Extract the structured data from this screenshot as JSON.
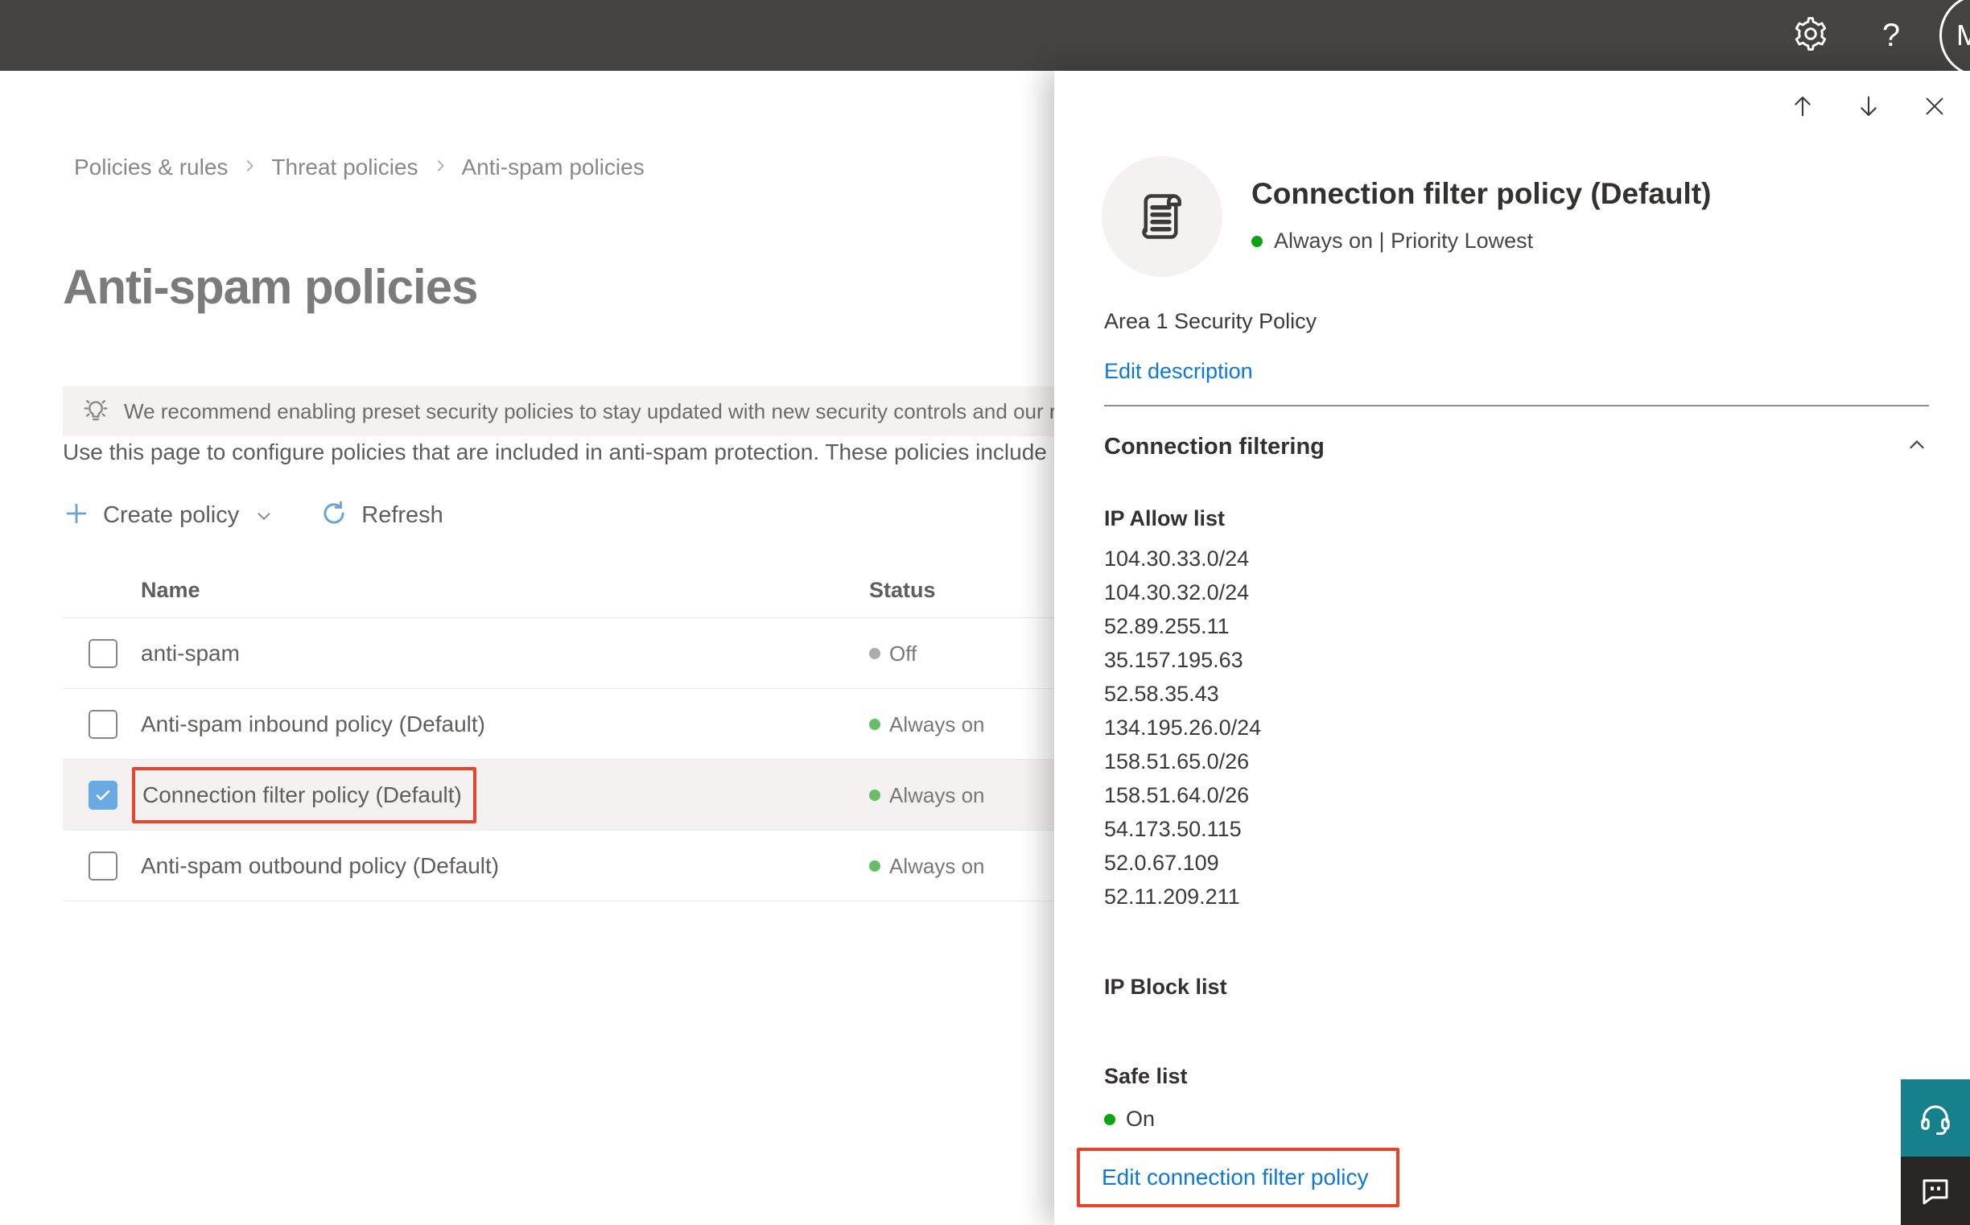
{
  "topbar": {
    "help_label": "?",
    "avatar_initial": "M"
  },
  "breadcrumb": {
    "items": [
      "Policies & rules",
      "Threat policies",
      "Anti-spam policies"
    ]
  },
  "page": {
    "title": "Anti-spam policies",
    "banner_text": "We recommend enabling preset security policies to stay updated with new security controls and our recomme",
    "description": "Use this page to configure policies that are included in anti-spam protection. These policies include",
    "toolbar": {
      "create_policy_label": "Create policy",
      "refresh_label": "Refresh"
    }
  },
  "table": {
    "columns": {
      "name": "Name",
      "status": "Status"
    },
    "rows": [
      {
        "name": "anti-spam",
        "status": "Off",
        "checked": false,
        "selected": false
      },
      {
        "name": "Anti-spam inbound policy (Default)",
        "status": "Always on",
        "checked": false,
        "selected": false
      },
      {
        "name": "Connection filter policy (Default)",
        "status": "Always on",
        "checked": true,
        "selected": true,
        "annotated": true
      },
      {
        "name": "Anti-spam outbound policy (Default)",
        "status": "Always on",
        "checked": false,
        "selected": false
      }
    ]
  },
  "panel": {
    "title": "Connection filter policy (Default)",
    "status_line": "Always on | Priority Lowest",
    "description": "Area 1 Security Policy",
    "edit_description_label": "Edit description",
    "section_title": "Connection filtering",
    "ip_allow": {
      "title": "IP Allow list",
      "ips": [
        "104.30.33.0/24",
        "104.30.32.0/24",
        "52.89.255.11",
        "35.157.195.63",
        "52.58.35.43",
        "134.195.26.0/24",
        "158.51.65.0/26",
        "158.51.64.0/26",
        "54.173.50.115",
        "52.0.67.109",
        "52.11.209.211"
      ]
    },
    "ip_block": {
      "title": "IP Block list"
    },
    "safe_list": {
      "title": "Safe list",
      "status": "On"
    },
    "edit_link_label": "Edit connection filter policy"
  },
  "colors": {
    "topbar_bg": "#454341",
    "accent_blue": "#0e78d4",
    "annotation_red": "#e8432d",
    "status_green": "#68bd68",
    "panel_status_green": "#10a310",
    "status_off_gray": "#aeaba9",
    "checkbox_checked_blue": "#69a9e4",
    "help_float_teal": "#17808d",
    "feedback_float_dark": "#272625"
  }
}
